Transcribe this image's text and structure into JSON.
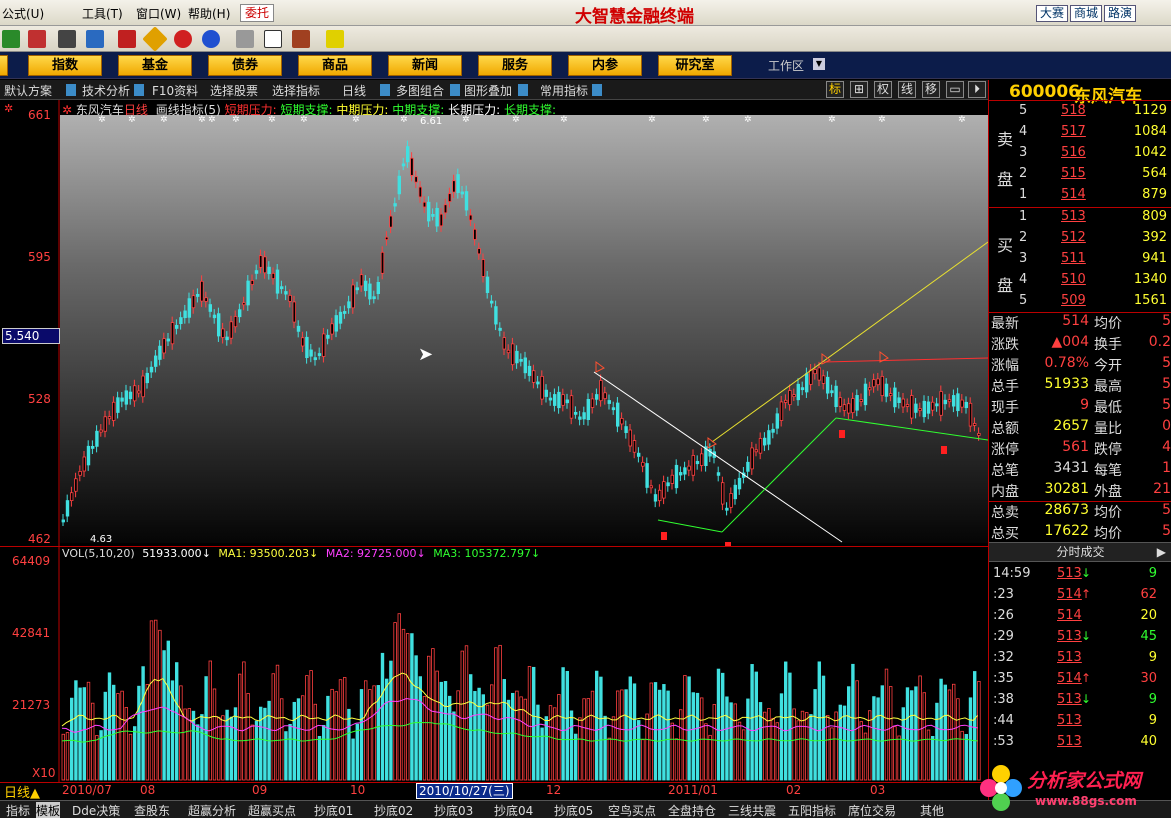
{
  "menu": [
    "公式(U)",
    "工具(T)",
    "窗口(W)",
    "帮助(H)"
  ],
  "entrust": "委托",
  "app_title": "大智慧金融终端",
  "top_links": [
    "大赛",
    "商城",
    "路演"
  ],
  "nav": [
    "指数",
    "基金",
    "债券",
    "商品",
    "新闻",
    "服务",
    "内参",
    "研究室"
  ],
  "workspace": "工作区",
  "chart_toolbar": {
    "items": [
      "默认方案",
      "技术分析",
      "F10资料",
      "选择股票",
      "选择指标",
      "日线",
      "多图组合",
      "图形叠加",
      "常用指标"
    ],
    "right": [
      "标",
      "⊞",
      "权",
      "线",
      "移",
      "▭",
      "⏵"
    ]
  },
  "chart_header": {
    "stock": "东风汽车",
    "period": "日线",
    "indicator": "画线指标(5)",
    "lines": [
      {
        "text": "短期压力:",
        "color": "#ff3030"
      },
      {
        "text": "短期支撑:",
        "color": "#30ff30"
      },
      {
        "text": "中期压力:",
        "color": "#ffff30"
      },
      {
        "text": "中期支撑:",
        "color": "#30ff30"
      },
      {
        "text": "长期压力:",
        "color": "#ffffff"
      },
      {
        "text": "长期支撑:",
        "color": "#30ff30"
      }
    ],
    "high_mark": "6.61",
    "low_mark": "4.63"
  },
  "price_axis": [
    "661",
    "595",
    "5.540",
    "528",
    "462"
  ],
  "vol_header": {
    "vol": "VOL(5,10,20)",
    "vol_val": "51933.000",
    "ma1": "MA1: 93500.203",
    "ma2": "MA2: 92725.000",
    "ma3": "MA3: 105372.797"
  },
  "vol_axis": [
    "64409",
    "42841",
    "21273",
    "X10"
  ],
  "bottom_dates": [
    "2010/07",
    "08",
    "09",
    "10",
    "12",
    "2011/01",
    "02",
    "03"
  ],
  "date_tip": "2010/10/27(三)",
  "period_label": "日线",
  "quote": {
    "code": "600006",
    "name": "东风汽车",
    "sell_side": "卖盘",
    "buy_side": "买盘",
    "asks": [
      {
        "lv": "5",
        "px": "518",
        "vol": "1129"
      },
      {
        "lv": "4",
        "px": "517",
        "vol": "1084"
      },
      {
        "lv": "3",
        "px": "516",
        "vol": "1042"
      },
      {
        "lv": "2",
        "px": "515",
        "vol": "564"
      },
      {
        "lv": "1",
        "px": "514",
        "vol": "879"
      }
    ],
    "bids": [
      {
        "lv": "1",
        "px": "513",
        "vol": "809"
      },
      {
        "lv": "2",
        "px": "512",
        "vol": "392"
      },
      {
        "lv": "3",
        "px": "511",
        "vol": "941"
      },
      {
        "lv": "4",
        "px": "510",
        "vol": "1340"
      },
      {
        "lv": "5",
        "px": "509",
        "vol": "1561"
      }
    ],
    "stats": [
      {
        "k1": "最新",
        "v1": "514",
        "c1": "#ff4040",
        "k2": "均价",
        "v2": "5"
      },
      {
        "k1": "涨跌",
        "v1": "▲004",
        "c1": "#ff4040",
        "k2": "换手",
        "v2": "0.2"
      },
      {
        "k1": "涨幅",
        "v1": "0.78%",
        "c1": "#ff4040",
        "k2": "今开",
        "v2": "5"
      },
      {
        "k1": "总手",
        "v1": "51933",
        "c1": "#ffff30",
        "k2": "最高",
        "v2": "5"
      },
      {
        "k1": "现手",
        "v1": "9",
        "c1": "#ff4040",
        "k2": "最低",
        "v2": "5"
      },
      {
        "k1": "总额",
        "v1": "2657",
        "c1": "#ffff30",
        "k2": "量比",
        "v2": "0"
      },
      {
        "k1": "涨停",
        "v1": "561",
        "c1": "#ff4040",
        "k2": "跌停",
        "v2": "4"
      },
      {
        "k1": "总笔",
        "v1": "3431",
        "c1": "#dddddd",
        "k2": "每笔",
        "v2": "1"
      },
      {
        "k1": "内盘",
        "v1": "30281",
        "c1": "#ffff30",
        "k2": "外盘",
        "v2": "21"
      },
      {
        "k1": "总卖",
        "v1": "28673",
        "c1": "#ffff30",
        "k2": "均价",
        "v2": "5"
      },
      {
        "k1": "总买",
        "v1": "17622",
        "c1": "#ffff30",
        "k2": "均价",
        "v2": "5"
      }
    ],
    "ticks_title": "分时成交",
    "ticks": [
      {
        "t": "14:59",
        "p": "513",
        "dir": "down",
        "v": "9"
      },
      {
        "t": ":23",
        "p": "514",
        "dir": "up",
        "v": "62"
      },
      {
        "t": ":26",
        "p": "514",
        "dir": "",
        "v": "20"
      },
      {
        "t": ":29",
        "p": "513",
        "dir": "down",
        "v": "45"
      },
      {
        "t": ":32",
        "p": "513",
        "dir": "",
        "v": "9"
      },
      {
        "t": ":35",
        "p": "514",
        "dir": "up",
        "v": "30"
      },
      {
        "t": ":38",
        "p": "513",
        "dir": "down",
        "v": "9"
      },
      {
        "t": ":44",
        "p": "513",
        "dir": "",
        "v": "9"
      },
      {
        "t": ":53",
        "p": "513",
        "dir": "",
        "v": "40"
      }
    ]
  },
  "tabs": [
    "指标",
    "模板",
    "Dde决策",
    "查股东",
    "超赢分析",
    "超赢买点",
    "抄底01",
    "抄底02",
    "抄底03",
    "抄底04",
    "抄底05",
    "空鸟买点",
    "全盘持仓",
    "三线共震",
    "五阳指标",
    "席位交易",
    "其他"
  ],
  "watermark": {
    "title": "分析家公式网",
    "url": "www.88gs.com"
  },
  "colors": {
    "up": "#ff4040",
    "down": "#40e0e0",
    "accent": "#ffd000"
  }
}
